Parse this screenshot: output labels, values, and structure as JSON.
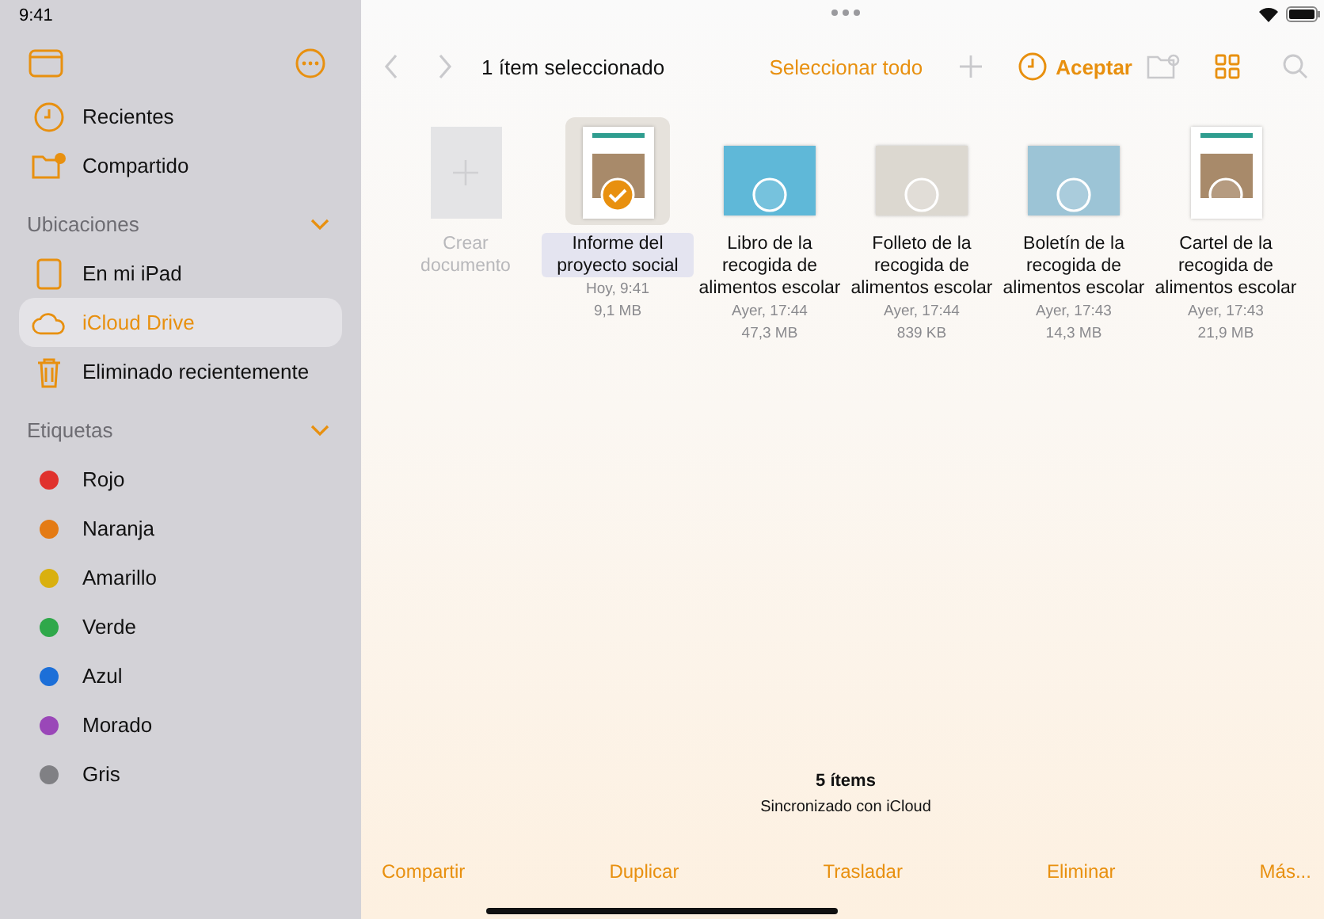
{
  "status_bar": {
    "time": "9:41"
  },
  "sidebar": {
    "top_items": [
      {
        "kind": "recents",
        "label": "Recientes",
        "selected": false
      },
      {
        "kind": "shared",
        "label": "Compartido",
        "selected": false
      }
    ],
    "sections": [
      {
        "title": "Ubicaciones",
        "expanded": true,
        "items": [
          {
            "kind": "ipad",
            "label": "En mi iPad",
            "selected": false
          },
          {
            "kind": "cloud",
            "label": "iCloud Drive",
            "selected": true
          },
          {
            "kind": "trash",
            "label": "Eliminado recientemente",
            "selected": false
          }
        ]
      },
      {
        "title": "Etiquetas",
        "expanded": true,
        "items": [
          {
            "kind": "tag",
            "label": "Rojo",
            "color": "#e0322d",
            "selected": false
          },
          {
            "kind": "tag",
            "label": "Naranja",
            "color": "#e47b14",
            "selected": false
          },
          {
            "kind": "tag",
            "label": "Amarillo",
            "color": "#d9b00f",
            "selected": false
          },
          {
            "kind": "tag",
            "label": "Verde",
            "color": "#2fa84a",
            "selected": false
          },
          {
            "kind": "tag",
            "label": "Azul",
            "color": "#1c6fd8",
            "selected": false
          },
          {
            "kind": "tag",
            "label": "Morado",
            "color": "#9a47b8",
            "selected": false
          },
          {
            "kind": "tag",
            "label": "Gris",
            "color": "#808084",
            "selected": false
          }
        ]
      }
    ]
  },
  "toolbar": {
    "title": "1 ítem seleccionado",
    "select_all": "Seleccionar todo",
    "done": "Aceptar"
  },
  "create": {
    "label": "Crear documento"
  },
  "files": [
    {
      "kind": "portrait",
      "name": "Informe del proyecto social",
      "date": "Hoy, 9:41",
      "size": "9,1 MB",
      "selected": true
    },
    {
      "kind": "landscape",
      "name": "Libro de la recogida de alimentos escolar",
      "date": "Ayer, 17:44",
      "size": "47,3 MB",
      "selected": false
    },
    {
      "kind": "landscape",
      "name": "Folleto de la recogida de alimentos escolar",
      "date": "Ayer, 17:44",
      "size": "839 KB",
      "selected": false
    },
    {
      "kind": "landscape",
      "name": "Boletín de la recogida de alimentos escolar",
      "date": "Ayer, 17:43",
      "size": "14,3 MB",
      "selected": false
    },
    {
      "kind": "portrait",
      "name": "Cartel de la recogida de alimentos escolar",
      "date": "Ayer, 17:43",
      "size": "21,9 MB",
      "selected": false
    }
  ],
  "summary": {
    "count": "5 ítems",
    "sync": "Sincronizado con iCloud"
  },
  "actions": [
    "Compartir",
    "Duplicar",
    "Trasladar",
    "Eliminar",
    "Más..."
  ]
}
